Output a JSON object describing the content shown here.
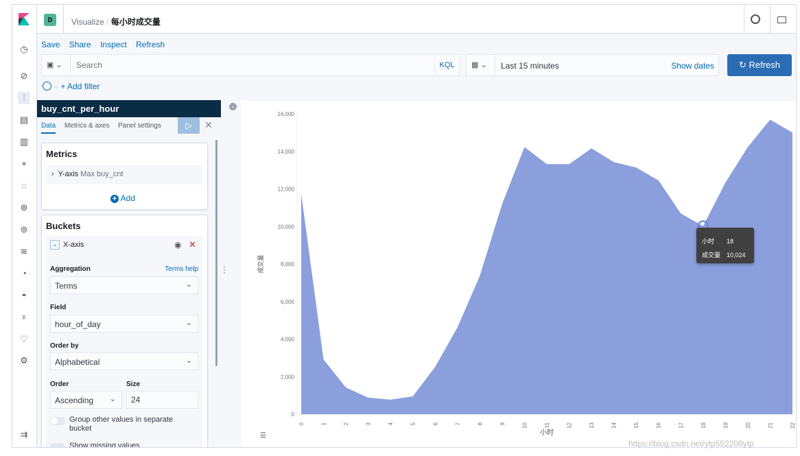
{
  "header": {
    "space_badge": "D",
    "breadcrumb": [
      "Visualize",
      "每小时成交量"
    ],
    "icons": [
      "help-icon",
      "mail-icon"
    ]
  },
  "nav": {
    "icons": [
      "clock-icon",
      "discover-icon",
      "visualize-icon",
      "dashboard-icon",
      "canvas-icon",
      "maps-icon",
      "ml-icon",
      "infrastructure-icon",
      "logs-icon",
      "apm-icon",
      "uptime-icon",
      "siem-icon",
      "dev-tools-icon",
      "monitoring-icon",
      "management-icon",
      "collapse-icon"
    ]
  },
  "toolbar": {
    "save": "Save",
    "share": "Share",
    "inspect": "Inspect",
    "refresh": "Refresh"
  },
  "query": {
    "placeholder": "Search",
    "language": "KQL",
    "time_range": "Last 15 minutes",
    "show_dates": "Show dates",
    "refresh_button": "Refresh",
    "add_filter": "+ Add filter"
  },
  "editor": {
    "title": "buy_cnt_per_hour",
    "tabs": [
      "Data",
      "Metrics & axes",
      "Panel settings"
    ],
    "metrics": {
      "title": "Metrics",
      "item_label": "Y-axis",
      "item_desc": "Max buy_cnt",
      "add": "Add"
    },
    "buckets": {
      "title": "Buckets",
      "item_label": "X-axis",
      "aggregation_label": "Aggregation",
      "terms_help": "Terms help",
      "aggregation": "Terms",
      "field_label": "Field",
      "field": "hour_of_day",
      "order_by_label": "Order by",
      "order_by": "Alphabetical",
      "order_label": "Order",
      "order": "Ascending",
      "size_label": "Size",
      "size": "24",
      "group_other": "Group other values in separate bucket",
      "show_missing": "Show missing values"
    }
  },
  "colors": {
    "accent": "#006bb4",
    "area": "#8a9fdc",
    "header_dark": "#0b2c45",
    "refresh_button": "#2a6db5"
  },
  "chart_data": {
    "type": "area",
    "xlabel": "小时",
    "ylabel": "成交量",
    "categories": [
      "0",
      "1",
      "2",
      "3",
      "4",
      "5",
      "6",
      "7",
      "8",
      "9",
      "10",
      "11",
      "12",
      "13",
      "14",
      "15",
      "16",
      "17",
      "18",
      "19",
      "20",
      "21",
      "22"
    ],
    "values": [
      11750,
      2920,
      1420,
      880,
      770,
      950,
      2520,
      4630,
      7370,
      11200,
      14230,
      13320,
      13320,
      14160,
      13430,
      13140,
      12450,
      10690,
      10024,
      12340,
      14230,
      15690,
      15000
    ],
    "ylim": [
      0,
      16000
    ],
    "yticks": [
      "0",
      "2,000",
      "4,000",
      "6,000",
      "8,000",
      "10,000",
      "12,000",
      "14,000",
      "16,000"
    ],
    "grid": false,
    "tooltip": {
      "x_label": "小时",
      "x_value": "18",
      "y_label": "成交量",
      "y_value": "10,024"
    }
  },
  "watermark": "https://blog.csdn.net/ytp552200ytp"
}
